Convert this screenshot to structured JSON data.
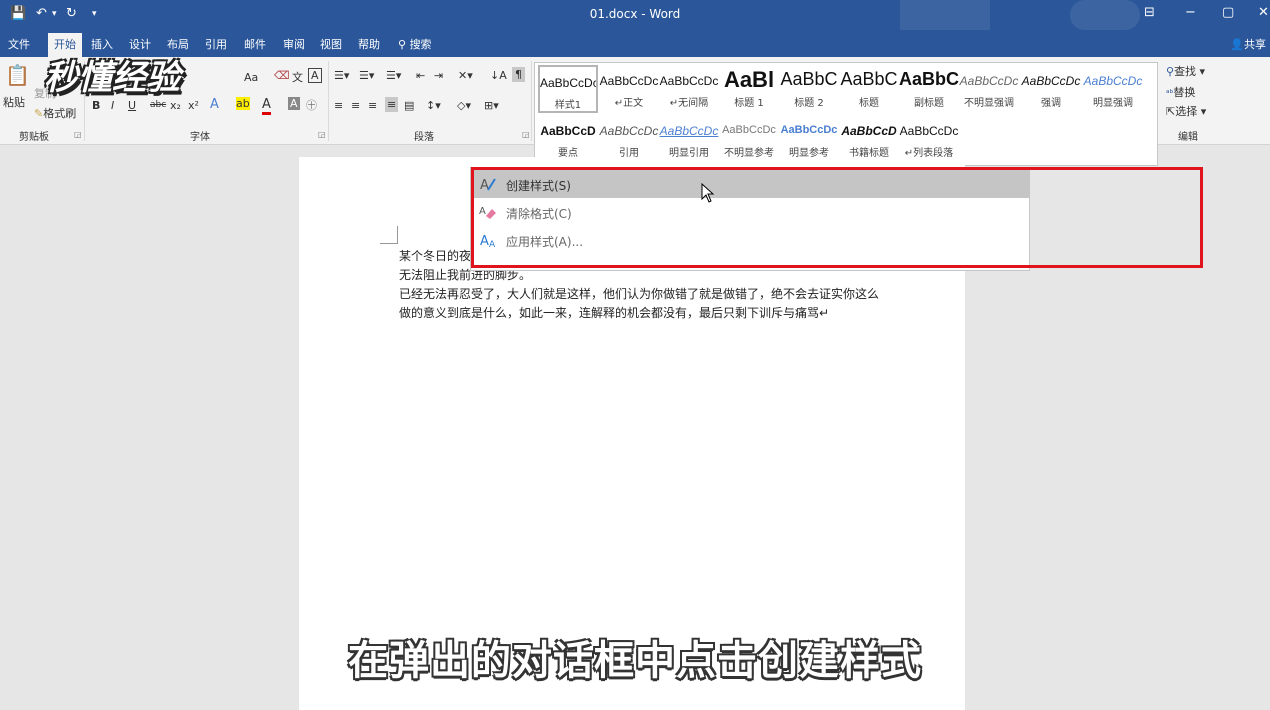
{
  "window": {
    "title": "01.docx - Word",
    "quick_access": [
      "💾",
      "↶",
      "▾",
      "↻",
      "▾"
    ]
  },
  "tabs": [
    "文件",
    "开始",
    "插入",
    "设计",
    "布局",
    "引用",
    "邮件",
    "审阅",
    "视图",
    "帮助"
  ],
  "tell_me": "搜索",
  "share": "共享",
  "ribbon": {
    "clipboard": {
      "paste": "粘贴",
      "copy": "复制",
      "format_painter": "格式刷",
      "label": "剪贴板"
    },
    "font": {
      "label": "字体",
      "size_down": "Aa",
      "bold": "B",
      "italic": "I",
      "underline": "U",
      "strike": "abc",
      "sub": "x₂",
      "sup": "x²"
    },
    "paragraph": {
      "label": "段落"
    },
    "styles": [
      {
        "preview": "AaBbCcDc",
        "name": "样式1"
      },
      {
        "preview": "AaBbCcDc",
        "name": "↵正文"
      },
      {
        "preview": "AaBbCcDc",
        "name": "↵无间隔"
      },
      {
        "preview": "AaBl",
        "name": "标题 1"
      },
      {
        "preview": "AaBbC",
        "name": "标题 2"
      },
      {
        "preview": "AaBbC",
        "name": "标题"
      },
      {
        "preview": "AaBbC",
        "name": "副标题"
      },
      {
        "preview": "AaBbCcDc",
        "name": "不明显强调"
      },
      {
        "preview": "AaBbCcDc",
        "name": "强调"
      },
      {
        "preview": "AaBbCcDc",
        "name": "明显强调"
      },
      {
        "preview": "AaBbCcD",
        "name": "要点"
      },
      {
        "preview": "AaBbCcDc",
        "name": "引用"
      },
      {
        "preview": "AaBbCcDc",
        "name": "明显引用"
      },
      {
        "preview": "AaBbCcDc",
        "name": "不明显参考"
      },
      {
        "preview": "AaBbCcDc",
        "name": "明显参考"
      },
      {
        "preview": "AaBbCcD",
        "name": "书籍标题"
      },
      {
        "preview": "AaBbCcDc",
        "name": "↵列表段落"
      }
    ],
    "editing": {
      "find": "查找",
      "replace": "替换",
      "select": "选择",
      "label": "编辑"
    }
  },
  "menu": {
    "items": [
      {
        "label": "创建样式(S)"
      },
      {
        "label": "清除格式(C)"
      },
      {
        "label": "应用样式(A)..."
      }
    ]
  },
  "document": {
    "lines": [
      "某个冬日的夜",
      "无法阻止我前进的脚步。",
      "已经无法再忍受了，大人们就是这样，他们认为你做错了就是做错了，绝不会去证实你这么",
      "做的意义到底是什么，如此一来，连解释的机会都没有，最后只剩下训斥与痛骂↵"
    ]
  },
  "watermark": "秒懂经验",
  "caption": "在弹出的对话框中点击创建样式",
  "colors": {
    "accent": "#2b579a",
    "highlight": "#e0141c"
  }
}
